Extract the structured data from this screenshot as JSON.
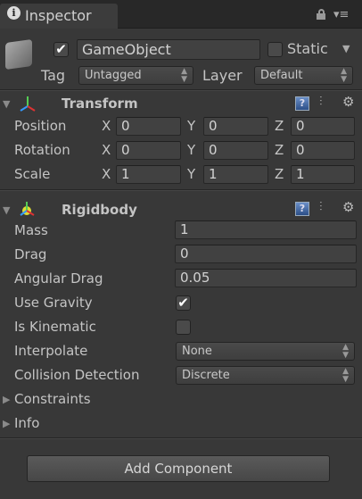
{
  "tab": {
    "title": "Inspector"
  },
  "header": {
    "active": true,
    "name": "GameObject",
    "static_label": "Static",
    "static": false,
    "tag_label": "Tag",
    "tag_value": "Untagged",
    "layer_label": "Layer",
    "layer_value": "Default"
  },
  "transform": {
    "title": "Transform",
    "rows": [
      {
        "label": "Position",
        "x": "0",
        "y": "0",
        "z": "0"
      },
      {
        "label": "Rotation",
        "x": "0",
        "y": "0",
        "z": "0"
      },
      {
        "label": "Scale",
        "x": "1",
        "y": "1",
        "z": "1"
      }
    ],
    "axis": {
      "x": "X",
      "y": "Y",
      "z": "Z"
    }
  },
  "rigidbody": {
    "title": "Rigidbody",
    "mass_label": "Mass",
    "mass": "1",
    "drag_label": "Drag",
    "drag": "0",
    "angular_drag_label": "Angular Drag",
    "angular_drag": "0.05",
    "use_gravity_label": "Use Gravity",
    "use_gravity": true,
    "is_kinematic_label": "Is Kinematic",
    "is_kinematic": false,
    "interpolate_label": "Interpolate",
    "interpolate": "None",
    "collision_label": "Collision Detection",
    "collision": "Discrete",
    "constraints_label": "Constraints",
    "info_label": "Info"
  },
  "add_component_label": "Add Component",
  "icons": {
    "help": "?",
    "checkmark": "✔"
  }
}
